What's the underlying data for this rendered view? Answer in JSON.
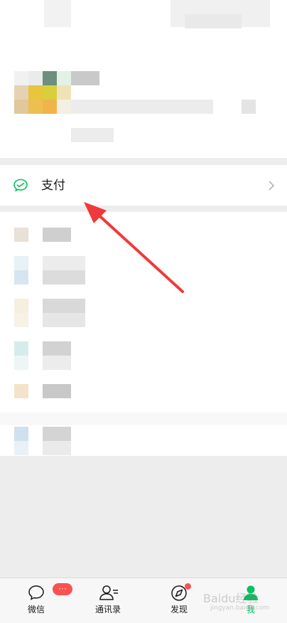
{
  "pay": {
    "label": "支付"
  },
  "tabs": [
    {
      "key": "chats",
      "label": "微信",
      "badge": "···",
      "icon": "chat-bubble-icon"
    },
    {
      "key": "contacts",
      "label": "通讯录",
      "icon": "contacts-icon"
    },
    {
      "key": "discover",
      "label": "发现",
      "icon": "compass-icon"
    },
    {
      "key": "me",
      "label": "我",
      "icon": "person-icon"
    }
  ],
  "colors": {
    "accent": "#07c160",
    "badge": "#fa5151",
    "annotation_arrow": "#f0393b"
  },
  "watermark": {
    "text": "Baidu经验",
    "sub": "jingyan.baidu.com"
  }
}
